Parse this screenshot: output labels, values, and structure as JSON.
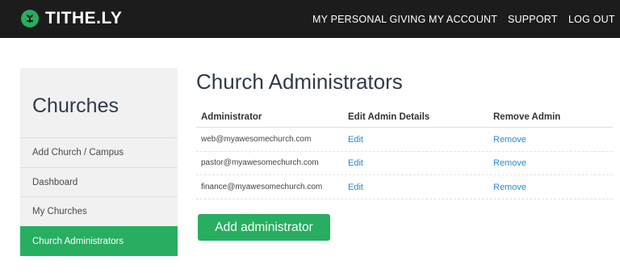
{
  "colors": {
    "topbar": "#1c1c1c",
    "brand_green": "#27ae60",
    "link_blue": "#2a8bd2",
    "sidebar_bg": "#f1f1f1"
  },
  "topbar": {
    "brand": "TITHE.LY",
    "nav": [
      "MY PERSONAL GIVING",
      "MY ACCOUNT",
      "SUPPORT",
      "LOG OUT"
    ]
  },
  "sidebar": {
    "title": "Churches",
    "items": [
      "Add Church / Campus",
      "Dashboard",
      "My Churches",
      "Church Administrators"
    ],
    "active": "Church Administrators"
  },
  "main": {
    "title": "Church Administrators",
    "columns": [
      "Administrator",
      "Edit Admin Details",
      "Remove Admin"
    ],
    "rows": [
      {
        "email": "web@myawesomechurch.com",
        "edit": "Edit",
        "remove": "Remove"
      },
      {
        "email": "pastor@myawesomechurch.com",
        "edit": "Edit",
        "remove": "Remove"
      },
      {
        "email": "finance@myawesomechurch.com",
        "edit": "Edit",
        "remove": "Remove"
      }
    ],
    "add_button": "Add administrator"
  }
}
